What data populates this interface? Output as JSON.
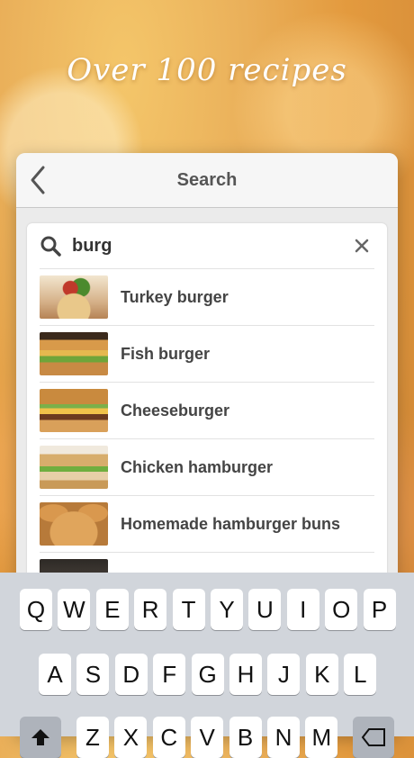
{
  "headline": "Over 100 recipes",
  "navbar": {
    "title": "Search"
  },
  "search": {
    "value": "burg"
  },
  "results": [
    {
      "label": "Turkey burger"
    },
    {
      "label": "Fish burger"
    },
    {
      "label": "Cheeseburger"
    },
    {
      "label": "Chicken hamburger"
    },
    {
      "label": "Homemade hamburger buns"
    }
  ],
  "keyboard": {
    "row1": [
      "Q",
      "W",
      "E",
      "R",
      "T",
      "Y",
      "U",
      "I",
      "O",
      "P"
    ],
    "row2": [
      "A",
      "S",
      "D",
      "F",
      "G",
      "H",
      "J",
      "K",
      "L"
    ],
    "row3": [
      "Z",
      "X",
      "C",
      "V",
      "B",
      "N",
      "M"
    ]
  },
  "colors": {
    "accent": "#e39a3e",
    "panel": "#ffffff",
    "keyboard": "#d1d5db"
  },
  "icons": {
    "back": "chevron-left-icon",
    "search": "search-icon",
    "clear": "close-icon",
    "shift": "shift-icon",
    "delete": "backspace-icon"
  }
}
